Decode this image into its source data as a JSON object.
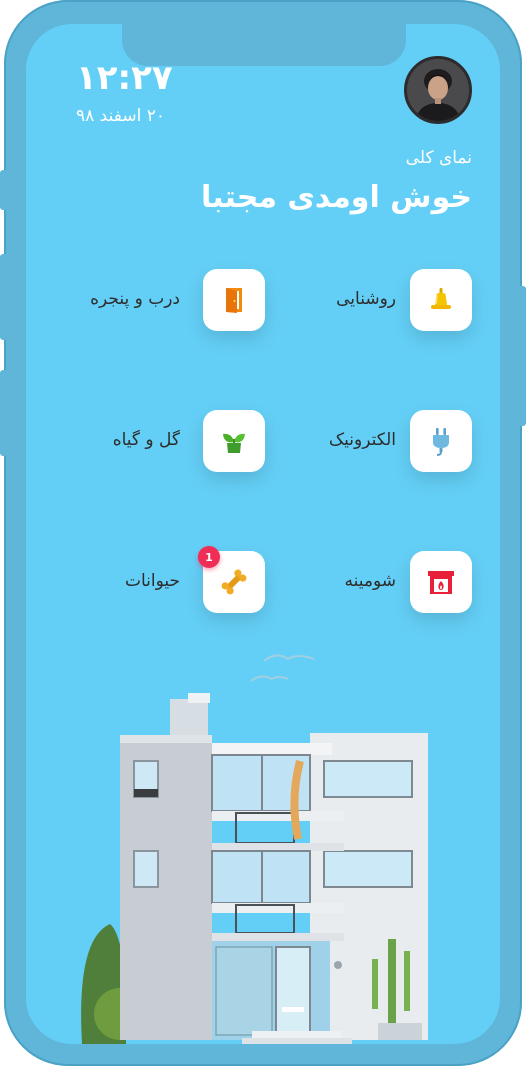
{
  "status": {
    "time": "۱۲:۲۷",
    "date": "۲۰ اسفند ۹۸"
  },
  "header": {
    "subtitle": "نمای کلی",
    "title": "خوش اومدی مجتبا"
  },
  "categories": [
    {
      "label": "روشنایی",
      "icon": "bell-icon"
    },
    {
      "label": "درب و پنجره",
      "icon": "door-icon"
    },
    {
      "label": "الکترونیک",
      "icon": "plug-icon"
    },
    {
      "label": "گل و گیاه",
      "icon": "plant-icon"
    },
    {
      "label": "شومینه",
      "icon": "fireplace-icon"
    },
    {
      "label": "حیوانات",
      "icon": "bone-icon",
      "badge": "1"
    }
  ],
  "colors": {
    "background": "#64cff6",
    "frame": "#5fb6d8",
    "badge": "#ef2d57"
  }
}
